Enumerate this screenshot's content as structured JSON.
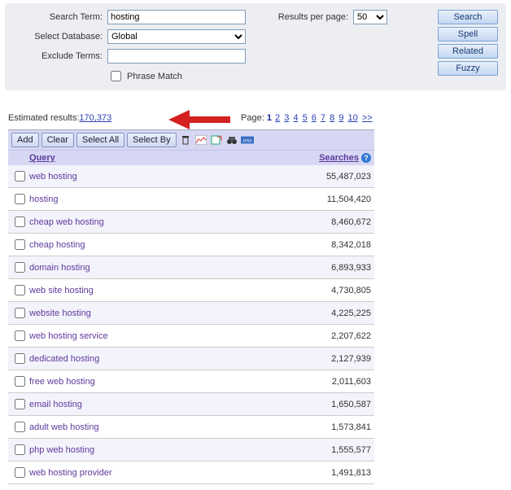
{
  "search": {
    "term_label": "Search Term:",
    "term_value": "hosting",
    "db_label": "Select Database:",
    "db_value": "Global",
    "exclude_label": "Exclude Terms:",
    "exclude_value": "",
    "phrase_label": "Phrase Match",
    "rpp_label": "Results per page:",
    "rpp_value": "50"
  },
  "buttons": {
    "search": "Search",
    "spell": "Spell",
    "related": "Related",
    "fuzzy": "Fuzzy"
  },
  "results": {
    "estimate_label": "Estimated results: ",
    "estimate_value": "170,373",
    "page_label": "Page: ",
    "current_page": "1",
    "pages": [
      "2",
      "3",
      "4",
      "5",
      "6",
      "7",
      "8",
      "9",
      "10"
    ],
    "next": ">>"
  },
  "toolbar": {
    "add": "Add",
    "clear": "Clear",
    "select_all": "Select All",
    "select_by": "Select By"
  },
  "table": {
    "col_query": "Query",
    "col_searches": "Searches",
    "rows": [
      {
        "q": "web hosting",
        "s": "55,487,023"
      },
      {
        "q": "hosting",
        "s": "11,504,420"
      },
      {
        "q": "cheap web hosting",
        "s": "8,460,672"
      },
      {
        "q": "cheap hosting",
        "s": "8,342,018"
      },
      {
        "q": "domain hosting",
        "s": "6,893,933"
      },
      {
        "q": "web site hosting",
        "s": "4,730,805"
      },
      {
        "q": "website hosting",
        "s": "4,225,225"
      },
      {
        "q": "web hosting service",
        "s": "2,207,622"
      },
      {
        "q": "dedicated hosting",
        "s": "2,127,939"
      },
      {
        "q": "free web hosting",
        "s": "2,011,603"
      },
      {
        "q": "email hosting",
        "s": "1,650,587"
      },
      {
        "q": "adult web hosting",
        "s": "1,573,841"
      },
      {
        "q": "php web hosting",
        "s": "1,555,577"
      },
      {
        "q": "web hosting provider",
        "s": "1,491,813"
      }
    ]
  }
}
